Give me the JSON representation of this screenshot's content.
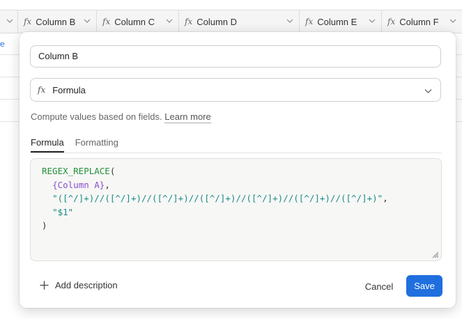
{
  "grid": {
    "columns": [
      {
        "label": "Column B"
      },
      {
        "label": "Column C"
      },
      {
        "label": "Column D"
      },
      {
        "label": "Column E"
      },
      {
        "label": "Column F"
      }
    ],
    "row_fragment": "e"
  },
  "dialog": {
    "field_name": "Column B",
    "field_type": "Formula",
    "type_icon": "fx-icon",
    "help_text": "Compute values based on fields.",
    "learn_more": "Learn more",
    "tabs": [
      {
        "label": "Formula",
        "active": true
      },
      {
        "label": "Formatting",
        "active": false
      }
    ],
    "formula": {
      "line1_fn": "REGEX_REPLACE",
      "line1_paren": "(",
      "line2_field": "{Column A}",
      "line2_comma": ",",
      "line3_str": "\"([^/]+)//([^/]+)//([^/]+)//([^/]+)//([^/]+)//([^/]+)//([^/]+)\"",
      "line3_comma": ",",
      "line4_str": "\"$1\"",
      "line5_paren": ")"
    },
    "add_description": "Add description",
    "cancel_label": "Cancel",
    "save_label": "Save",
    "colors": {
      "primary": "#1f6fde",
      "function": "#21913a",
      "field": "#8a4fd0",
      "string": "#1a8a86"
    }
  }
}
